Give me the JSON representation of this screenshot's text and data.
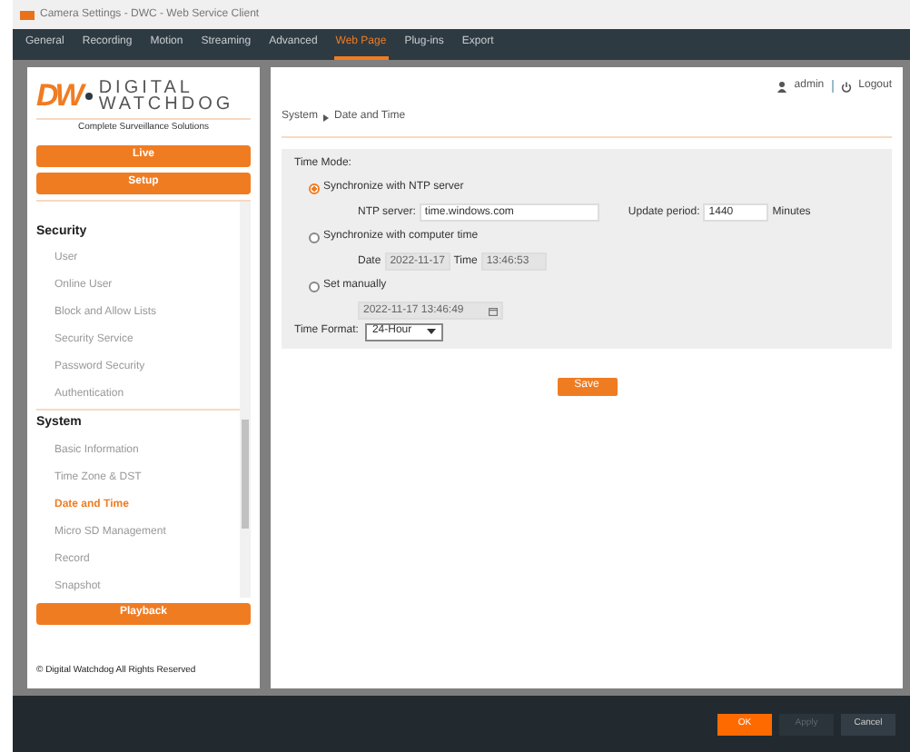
{
  "window": {
    "title": "Camera Settings - DWC - Web Service Client"
  },
  "tabs": [
    {
      "label": "General",
      "selected": false
    },
    {
      "label": "Recording",
      "selected": false
    },
    {
      "label": "Motion",
      "selected": false
    },
    {
      "label": "Streaming",
      "selected": false
    },
    {
      "label": "Advanced",
      "selected": false
    },
    {
      "label": "Web Page",
      "selected": true
    },
    {
      "label": "Plug-ins",
      "selected": false
    },
    {
      "label": "Export",
      "selected": false
    }
  ],
  "sidebar": {
    "logo": {
      "mark": "DW",
      "name_top": "DIGITAL",
      "name_bottom": "WATCHDOG",
      "tagline": "Complete Surveillance Solutions"
    },
    "top_buttons": [
      "Live",
      "Setup"
    ],
    "sections": [
      {
        "heading": "Security",
        "items": [
          {
            "label": "User",
            "selected": false
          },
          {
            "label": "Online User",
            "selected": false
          },
          {
            "label": "Block and Allow Lists",
            "selected": false
          },
          {
            "label": "Security Service",
            "selected": false
          },
          {
            "label": "Password Security",
            "selected": false
          },
          {
            "label": "Authentication",
            "selected": false
          }
        ]
      },
      {
        "heading": "System",
        "items": [
          {
            "label": "Basic Information",
            "selected": false
          },
          {
            "label": "Time Zone & DST",
            "selected": false
          },
          {
            "label": "Date and Time",
            "selected": true
          },
          {
            "label": "Micro SD Management",
            "selected": false
          },
          {
            "label": "Record",
            "selected": false
          },
          {
            "label": "Snapshot",
            "selected": false
          }
        ]
      }
    ],
    "bottom_button": "Playback",
    "copyright": "© Digital Watchdog All Rights Reserved"
  },
  "header": {
    "user": "admin",
    "logout": "Logout"
  },
  "breadcrumb": [
    "System",
    "Date and Time"
  ],
  "time_mode": {
    "label": "Time Mode:",
    "options": [
      {
        "label": "Synchronize with NTP server",
        "selected": true,
        "fields": [
          {
            "label": "NTP server:",
            "value": "time.windows.com",
            "disabled": false,
            "kind": "text"
          },
          {
            "label": "Update period:",
            "value": "1440",
            "suffix": "Minutes",
            "disabled": false,
            "kind": "short"
          }
        ]
      },
      {
        "label": "Synchronize with computer time",
        "selected": false,
        "fields": [
          {
            "label": "Date",
            "value": "2022-11-17",
            "disabled": true,
            "kind": "short"
          },
          {
            "label": "Time",
            "value": "13:46:53",
            "disabled": true,
            "kind": "short"
          }
        ]
      },
      {
        "label": "Set manually",
        "selected": false,
        "fields": [
          {
            "value": "2022-11-17 13:46:49",
            "disabled": true,
            "kind": "datetime"
          }
        ]
      }
    ]
  },
  "time_format": {
    "label": "Time Format:",
    "value": "24-Hour"
  },
  "save_button": "Save",
  "footer_buttons": [
    {
      "label": "OK",
      "kind": "primary",
      "disabled": false
    },
    {
      "label": "Apply",
      "kind": "secondary",
      "disabled": true
    },
    {
      "label": "Cancel",
      "kind": "secondary",
      "disabled": false
    }
  ]
}
